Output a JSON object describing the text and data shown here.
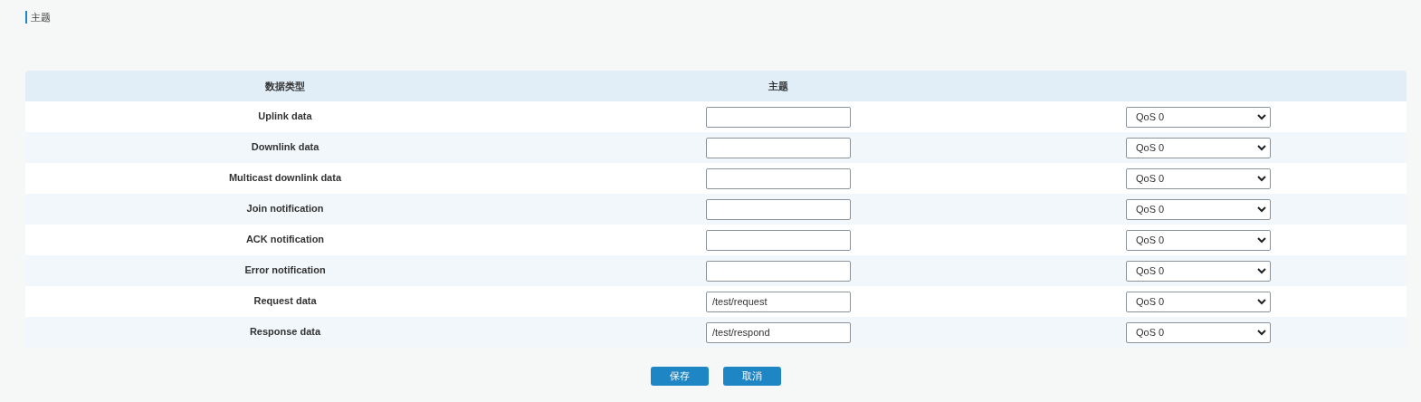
{
  "section_title": "主题",
  "table": {
    "columns": [
      "数据类型",
      "主题"
    ],
    "rows": [
      {
        "data_type": "Uplink data",
        "topic": "",
        "qos": "QoS 0"
      },
      {
        "data_type": "Downlink data",
        "topic": "",
        "qos": "QoS 0"
      },
      {
        "data_type": "Multicast downlink data",
        "topic": "",
        "qos": "QoS 0"
      },
      {
        "data_type": "Join notification",
        "topic": "",
        "qos": "QoS 0"
      },
      {
        "data_type": "ACK notification",
        "topic": "",
        "qos": "QoS 0"
      },
      {
        "data_type": "Error notification",
        "topic": "",
        "qos": "QoS 0"
      },
      {
        "data_type": "Request data",
        "topic": "/test/request",
        "qos": "QoS 0"
      },
      {
        "data_type": "Response data",
        "topic": "/test/respond",
        "qos": "QoS 0"
      }
    ]
  },
  "buttons": [
    "保存",
    "取消"
  ]
}
